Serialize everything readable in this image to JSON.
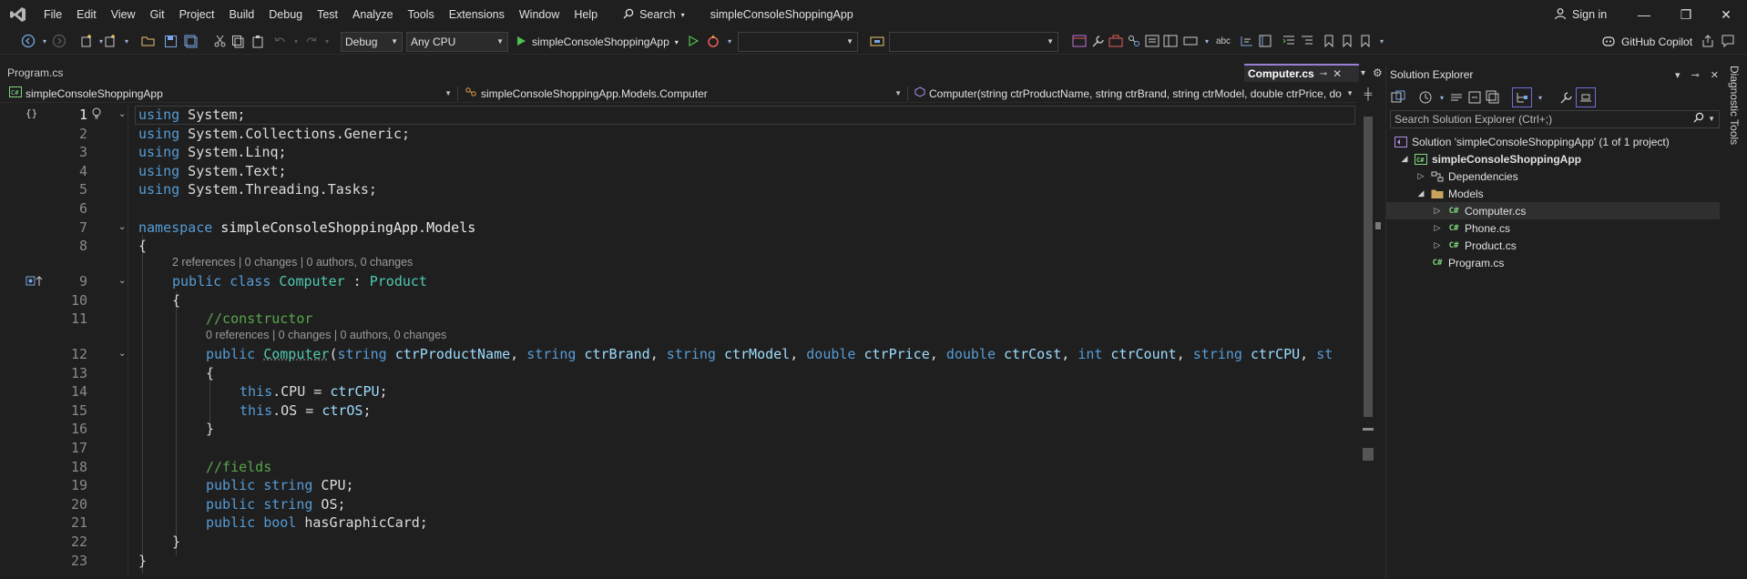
{
  "menu": {
    "items": [
      "File",
      "Edit",
      "View",
      "Git",
      "Project",
      "Build",
      "Debug",
      "Test",
      "Analyze",
      "Tools",
      "Extensions",
      "Window",
      "Help"
    ],
    "search_label": "Search",
    "app_title": "simpleConsoleShoppingApp",
    "sign_in": "Sign in"
  },
  "toolbar": {
    "config": "Debug",
    "platform": "Any CPU",
    "run_target": "simpleConsoleShoppingApp",
    "copilot": "GitHub Copilot"
  },
  "tabs": {
    "inactive": "Program.cs",
    "active": "Computer.cs"
  },
  "navbar": {
    "project": "simpleConsoleShoppingApp",
    "type": "simpleConsoleShoppingApp.Models.Computer",
    "member": "Computer(string ctrProductName, string ctrBrand, string ctrModel, double ctrPrice, do"
  },
  "editor": {
    "line_numbers": [
      "1",
      "2",
      "3",
      "4",
      "5",
      "6",
      "7",
      "8",
      "9",
      "10",
      "11",
      "12",
      "13",
      "14",
      "15",
      "16",
      "17",
      "18",
      "19",
      "20",
      "21",
      "22",
      "23"
    ],
    "codelens_class": "2 references | 0 changes | 0 authors, 0 changes",
    "codelens_ctor": "0 references | 0 changes | 0 authors, 0 changes",
    "t": {
      "using": "using",
      "system": " System;",
      "collections": " System.Collections.Generic;",
      "linq": " System.Linq;",
      "text": " System.Text;",
      "tasks": " System.Threading.Tasks;",
      "namespace": "namespace",
      "ns_name": " simpleConsoleShoppingApp.Models",
      "brace_open": "{",
      "brace_close": "}",
      "public": "public",
      "class": " class ",
      "computer": "Computer",
      "colon": " : ",
      "product": "Product",
      "comment_ctor": "//constructor",
      "comment_fields": "//fields",
      "paren": "(",
      "string": "string",
      "double": "double",
      "int": "int",
      "bool": "bool",
      "p_name": " ctrProductName",
      "p_brand": " ctrBrand",
      "p_model": " ctrModel",
      "p_price": " ctrPrice",
      "p_cost": " ctrCost",
      "p_count": " ctrCount",
      "p_cpu": " ctrCPU",
      "comma": ", ",
      "st_trunc": "st",
      "this": "this",
      "cpu_assign": ".CPU = ",
      "os_assign": ".OS = ",
      "ctrcpu": "ctrCPU",
      "ctros": "ctrOS",
      "semi": ";",
      "f_cpu": " CPU;",
      "f_os": " OS;",
      "f_gfx": " hasGraphicCard;",
      "sp": " "
    }
  },
  "solution_explorer": {
    "title": "Solution Explorer",
    "search_placeholder": "Search Solution Explorer (Ctrl+;)",
    "solution": "Solution 'simpleConsoleShoppingApp' (1 of 1 project)",
    "project": "simpleConsoleShoppingApp",
    "dependencies": "Dependencies",
    "models": "Models",
    "files": [
      "Computer.cs",
      "Phone.cs",
      "Product.cs"
    ],
    "program": "Program.cs"
  },
  "side_panel": {
    "diagnostic_tools": "Diagnostic Tools"
  },
  "colors": {
    "keyword": "#569cd6",
    "type": "#4ec9b0",
    "method": "#dcdcaa",
    "parameter": "#9cdcfe",
    "comment": "#57a64a",
    "active_tab_accent": "#9a7fd6"
  }
}
